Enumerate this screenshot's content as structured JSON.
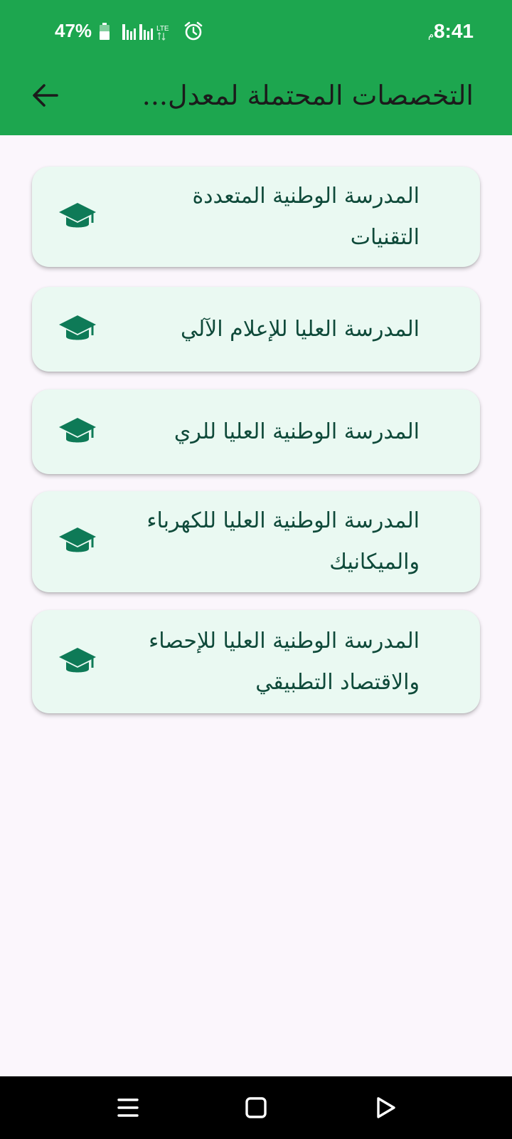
{
  "status_bar": {
    "battery": "47%",
    "network": "LTE",
    "time": "8:41",
    "ampm": "م"
  },
  "app_bar": {
    "title": "التخصصات المحتملة لمعدل..."
  },
  "schools": [
    {
      "label": "المدرسة الوطنية المتعددة التقنيات",
      "icon": "graduation-cap-icon"
    },
    {
      "label": "المدرسة العليا للإعلام الآلي",
      "icon": "graduation-cap-icon"
    },
    {
      "label": "المدرسة الوطنية العليا للري",
      "icon": "graduation-cap-icon"
    },
    {
      "label": "المدرسة الوطنية العليا للكهرباء والميكانيك",
      "icon": "graduation-cap-icon"
    },
    {
      "label": "المدرسة الوطنية العليا للإحصاء والاقتصاد التطبيقي",
      "icon": "graduation-cap-icon"
    }
  ],
  "colors": {
    "header": "#1DA64F",
    "card_bg": "#EAF9F2",
    "icon": "#0E7A57",
    "text": "#0F4A3A",
    "page_bg": "#FBF6FC"
  }
}
